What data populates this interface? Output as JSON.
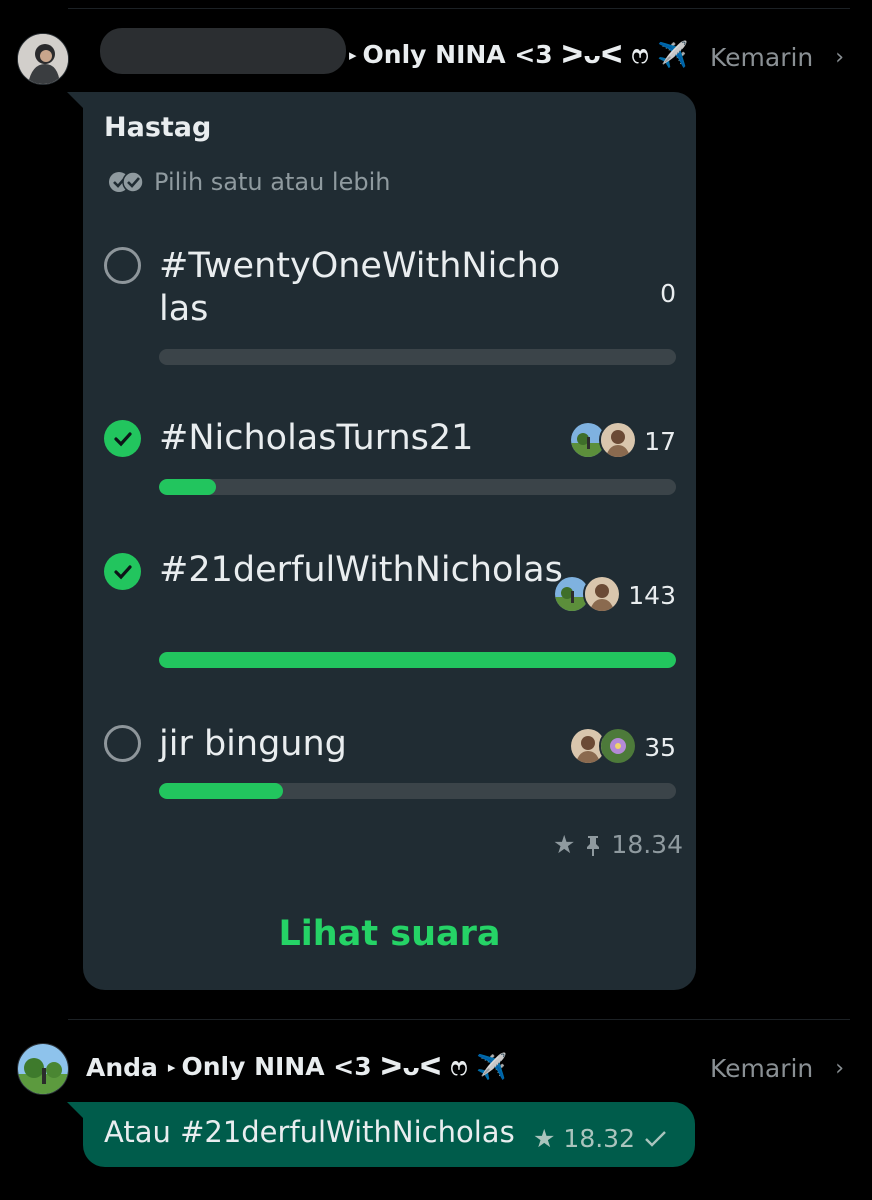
{
  "message1": {
    "sender_separator": "▸",
    "group_name": "Only NINA <3 ᐳᴗᐸ ෆ ✈️",
    "time_label": "Kemarin",
    "poll": {
      "question": "Hastag",
      "hint": "Pilih satu atau lebih",
      "options": [
        {
          "label": "#TwentyOneWithNicholas",
          "votes": "0",
          "selected": false,
          "fraction": 0
        },
        {
          "label": "#NicholasTurns21",
          "votes": "17",
          "selected": true,
          "fraction": 0.11
        },
        {
          "label": "#21derfulWithNicholas",
          "votes": "143",
          "selected": true,
          "fraction": 1.0
        },
        {
          "label": "jir bingung",
          "votes": "35",
          "selected": false,
          "fraction": 0.24
        }
      ],
      "time": "18.34",
      "action_label": "Lihat suara"
    }
  },
  "message2": {
    "sender": "Anda",
    "sender_separator": "▸",
    "group_name": "Only NINA <3 ᐳᴗᐸ ෆ ✈️",
    "time_label": "Kemarin",
    "text": "Atau #21derfulWithNicholas",
    "time": "18.32"
  },
  "colors": {
    "accent_green": "#22c55e",
    "incoming_bubble": "#202c33",
    "outgoing_bubble": "#005c4b",
    "background": "#000000"
  }
}
